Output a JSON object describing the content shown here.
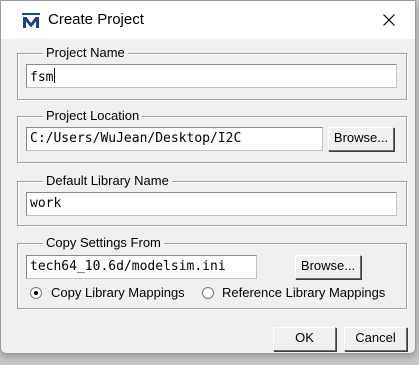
{
  "window": {
    "title": "Create Project",
    "icon": "modelsim-m-icon",
    "close_icon": "close-icon"
  },
  "project_name": {
    "legend": "Project Name",
    "value": "fsm"
  },
  "project_location": {
    "legend": "Project Location",
    "value": "C:/Users/WuJean/Desktop/I2C",
    "browse_label": "Browse..."
  },
  "default_library": {
    "legend": "Default Library Name",
    "value": "work"
  },
  "copy_settings": {
    "legend": "Copy Settings From",
    "value": "tech64_10.6d/modelsim.ini",
    "browse_label": "Browse...",
    "option_copy": "Copy Library Mappings",
    "option_reference": "Reference Library Mappings",
    "selected": "copy"
  },
  "footer": {
    "ok_label": "OK",
    "cancel_label": "Cancel"
  },
  "colors": {
    "logo_blue": "#1f3f93",
    "window_bg": "#f0f0f0"
  }
}
